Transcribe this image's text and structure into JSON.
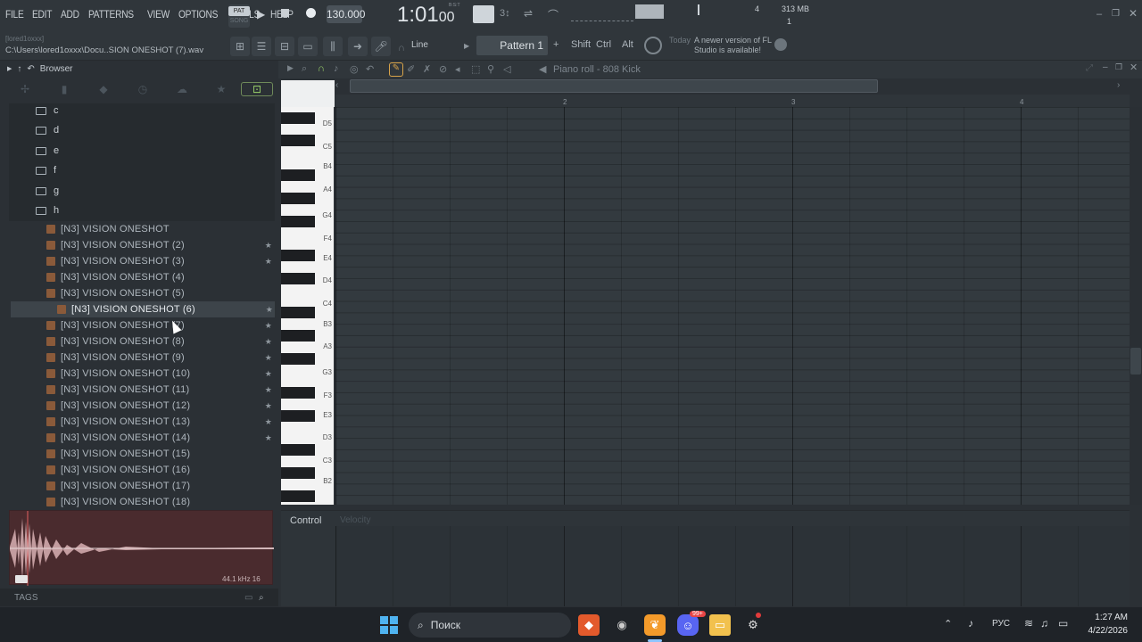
{
  "menu": [
    "FILE",
    "EDIT",
    "ADD",
    "PATTERNS",
    "VIEW",
    "OPTIONS",
    "TOOLS",
    "HELP"
  ],
  "transport": {
    "mode_top": "PAT",
    "mode_bottom": "SONG",
    "tempo": "130.000",
    "time": "1:01",
    "time_sub": "00",
    "time_unit": "B:S:T",
    "memory": "313 MB",
    "cpu_top": "4",
    "cpu_bottom": "1"
  },
  "hint": {
    "path_top": "[lored1oxxx]",
    "path": "C:\\Users\\lored1oxxx\\Docu..SION ONESHOT (7).wav"
  },
  "toolbar": {
    "snap": "Line",
    "pattern": "Pattern 1",
    "shift": "Shift",
    "ctrl": "Ctrl",
    "alt": "Alt",
    "news_label": "Today",
    "news_text": "A newer version of FL Studio is available!"
  },
  "browser": {
    "title": "Browser",
    "folders": [
      "c",
      "d",
      "e",
      "f",
      "g",
      "h"
    ],
    "files": [
      {
        "name": "[N3] VISION ONESHOT",
        "star": false
      },
      {
        "name": "[N3] VISION ONESHOT (2)",
        "star": true
      },
      {
        "name": "[N3] VISION ONESHOT (3)",
        "star": true
      },
      {
        "name": "[N3] VISION ONESHOT (4)",
        "star": false
      },
      {
        "name": "[N3] VISION ONESHOT (5)",
        "star": false
      },
      {
        "name": "[N3] VISION ONESHOT (6)",
        "star": true,
        "selected": true
      },
      {
        "name": "[N3] VISION ONESHOT (7)",
        "star": true
      },
      {
        "name": "[N3] VISION ONESHOT (8)",
        "star": true
      },
      {
        "name": "[N3] VISION ONESHOT (9)",
        "star": true
      },
      {
        "name": "[N3] VISION ONESHOT (10)",
        "star": true
      },
      {
        "name": "[N3] VISION ONESHOT (11)",
        "star": true
      },
      {
        "name": "[N3] VISION ONESHOT (12)",
        "star": true
      },
      {
        "name": "[N3] VISION ONESHOT (13)",
        "star": true
      },
      {
        "name": "[N3] VISION ONESHOT (14)",
        "star": true
      },
      {
        "name": "[N3] VISION ONESHOT (15)",
        "star": false
      },
      {
        "name": "[N3] VISION ONESHOT (16)",
        "star": false
      },
      {
        "name": "[N3] VISION ONESHOT (17)",
        "star": false
      },
      {
        "name": "[N3] VISION ONESHOT (18)",
        "star": false
      }
    ],
    "sample_info": "44.1 kHz 16",
    "tags_label": "TAGS"
  },
  "piano_roll": {
    "title": "Piano roll - 808 Kick",
    "bars": [
      "2",
      "3",
      "4"
    ],
    "keys": [
      "D5",
      "C5",
      "B4",
      "A4",
      "G4",
      "F4",
      "E4",
      "D4",
      "C4",
      "B3",
      "A3",
      "G3",
      "F3",
      "E3",
      "D3",
      "C3",
      "B2"
    ],
    "control_label": "Control",
    "control_target": "Velocity"
  },
  "taskbar": {
    "search": "Поиск",
    "lang": "РУС",
    "time": "1:27 AM",
    "date": "4/22/2026",
    "badge": "99+"
  },
  "colors": {
    "accent": "#9bd36a",
    "waveform_bg": "#4a2b2e",
    "selected_row": "#3d444a"
  }
}
